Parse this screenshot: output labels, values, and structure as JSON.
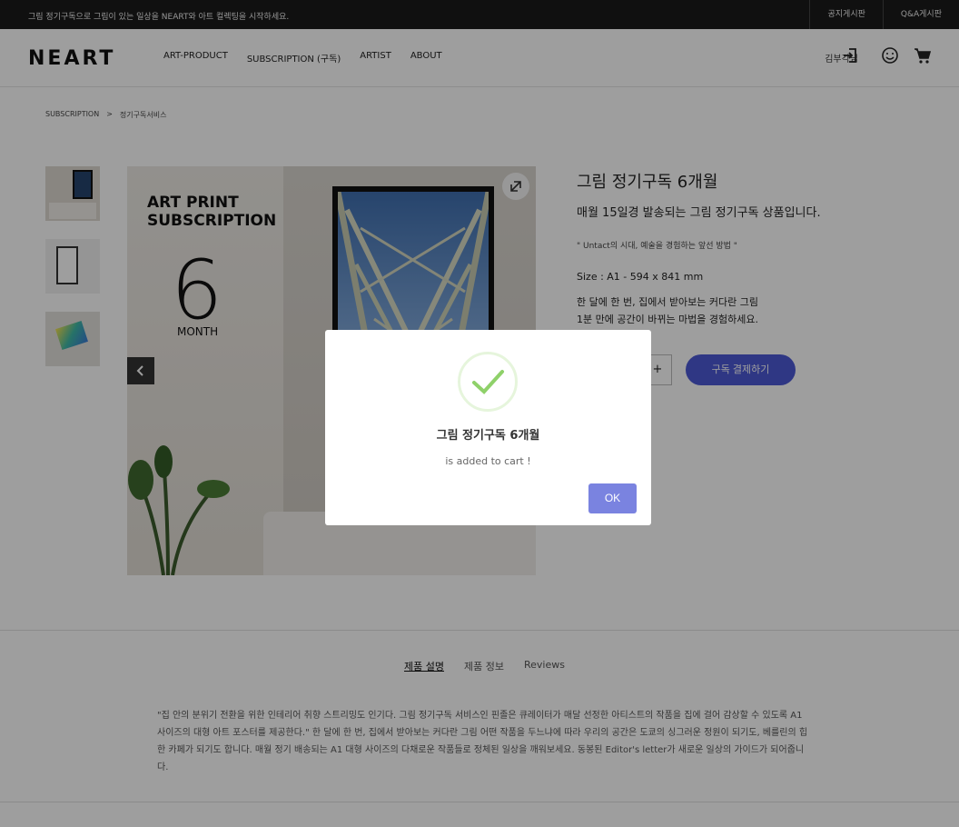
{
  "topbar": {
    "notice": "그림 정기구독으로 그림이 있는 일상을 NEART와 아트 컬렉팅을 시작하세요.",
    "links": [
      "공지게시판",
      "Q&A게시판"
    ]
  },
  "header": {
    "logo": "NEART",
    "nav": [
      "ART-PRODUCT",
      "SUBSCRIPTION (구독)",
      "ARTIST",
      "ABOUT"
    ],
    "user": "김부각님",
    "icons": [
      "login-icon",
      "smiley-icon",
      "cart-icon"
    ]
  },
  "breadcrumb": [
    "SUBSCRIPTION",
    ">",
    "정기구독서비스"
  ],
  "gallery": {
    "art_title": "ART PRINT SUBSCRIPTION",
    "art_number": "6",
    "art_month": "MONTH"
  },
  "product": {
    "title": "그림 정기구독 6개월",
    "subtitle": "매월 15일경 발송되는 그림 정기구독 상품입니다.",
    "quote": "\" Untact의 시대, 예술을 경험하는 앞선 방법 \"",
    "size": "Size : A1 - 594 x 841 mm",
    "desc_line1": "한 달에 한 번, 집에서 받아보는 커다란 그림",
    "desc_line2": "1분 만에 공간이 바뀌는 마법을 경험하세요.",
    "qty_plus": "+",
    "buy_label": "구독 결제하기"
  },
  "tabs": [
    "제품 설명",
    "제품 정보",
    "Reviews"
  ],
  "description": "\"집 안의 분위기 전환을 위한 인테리어 취향 스트리밍도 인기다. 그림 정기구독 서비스인 핀졸은 큐레이터가 매달 선정한 아티스트의 작품을 집에 걸어 감상할 수 있도록 A1 사이즈의 대형 아트 포스터를 제공한다.\" 한 달에 한 번, 집에서 받아보는 커다란 그림 어떤 작품을 두느냐에 따라 우리의 공간은 도쿄의 싱그러운 정원이 되기도, 베를린의 힙한 카페가 되기도 합니다. 매월 정기 배송되는 A1 대형 사이즈의 다채로운 작품들로 정체된 일상을 깨워보세요. 동봉된 Editor's letter가 새로운 일상의 가이드가 되어줍니다.",
  "modal": {
    "title": "그림 정기구독 6개월",
    "message": "is added to cart !",
    "ok_label": "OK"
  },
  "colors": {
    "accent": "#4c59d6",
    "ok_button": "#7a83e0",
    "check": "#8fd16a"
  }
}
